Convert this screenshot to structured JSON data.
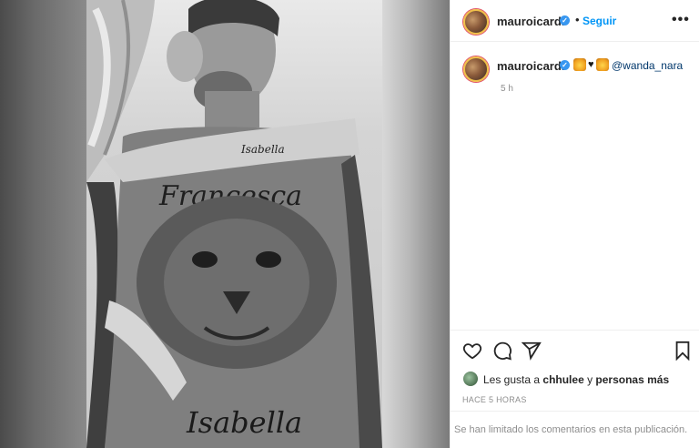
{
  "post": {
    "username": "mauroicardi",
    "verified": true,
    "follow_label": "Seguir",
    "separator": "•",
    "more_label": "•••"
  },
  "caption": {
    "username": "mauroicardi",
    "emojis": [
      "lion-face-emoji",
      "black-heart-emoji",
      "lion-face-emoji"
    ],
    "heart_glyph": "♥",
    "mention": "@wanda_nara",
    "time_ago": "5 h"
  },
  "photo": {
    "tattoo_arm_text": "Isabella",
    "tattoo_chest_text": "Francesca",
    "tattoo_belly_text": "Isabella"
  },
  "likes": {
    "prefix": "Les gusta a ",
    "user": "chhulee",
    "middle": " y ",
    "others": "personas más"
  },
  "post_date": "HACE 5 HORAS",
  "comments_notice": "Se han limitado los comentarios en esta publicación.",
  "icons": {
    "like": "heart-icon",
    "comment": "comment-icon",
    "share": "paper-plane-icon",
    "save": "bookmark-icon",
    "verified": "verified-badge-icon"
  },
  "colors": {
    "follow_blue": "#0095f6",
    "verified_blue": "#3897f0",
    "mention": "#00376b",
    "muted": "#8e8e8e"
  }
}
